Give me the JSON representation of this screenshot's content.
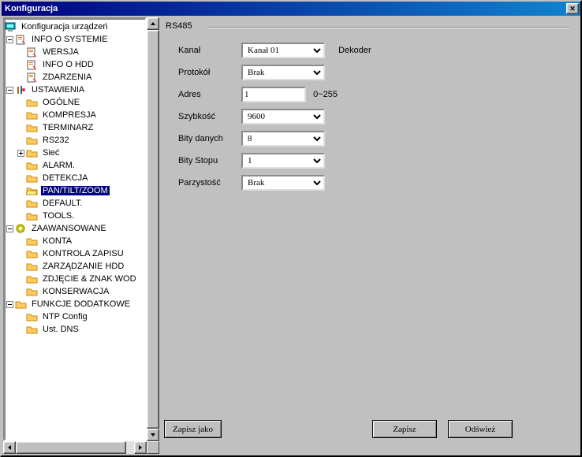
{
  "window": {
    "title": "Konfiguracja"
  },
  "tree": {
    "root": "Konfiguracja urządzeń",
    "info": {
      "title": "INFO O SYSTEMIE",
      "wersja": "WERSJA",
      "hdd": "INFO O HDD",
      "zdarzenia": "ZDARZENIA"
    },
    "settings": {
      "title": "USTAWIENIA",
      "ogolne": "OGÓLNE",
      "kompresja": "KOMPRESJA",
      "terminarz": "TERMINARZ",
      "rs232": "RS232",
      "siec": "Sieć",
      "alarm": "ALARM.",
      "detekcja": "DETEKCJA",
      "ptz": "PAN/TILT/ZOOM",
      "default": "DEFAULT.",
      "tools": "TOOLS."
    },
    "advanced": {
      "title": "ZAAWANSOWANE",
      "konta": "KONTA",
      "kontrola": "KONTROLA ZAPISU",
      "hdd": "ZARZĄDZANIE HDD",
      "znak": "ZDJĘCIE & ZNAK WOD",
      "konserwacja": "KONSERWACJA"
    },
    "extra": {
      "title": "FUNKCJE DODATKOWE",
      "ntp": "NTP Config",
      "dns": "Ust. DNS"
    }
  },
  "rs485": {
    "group_title": "RS485",
    "labels": {
      "kanal": "Kanał",
      "protokol": "Protokół",
      "adres": "Adres",
      "szybkosc": "Szybkość",
      "bity_danych": "Bity danych",
      "bity_stopu": "Bity Stopu",
      "parzystosc": "Parzystość"
    },
    "values": {
      "kanal": "Kanał 01",
      "protokol": "Brak",
      "adres": "1",
      "adres_range": "0~255",
      "szybkosc": "9600",
      "bity_danych": "8",
      "bity_stopu": "1",
      "parzystosc": "Brak"
    },
    "decoder_label": "Dekoder"
  },
  "buttons": {
    "save_as": "Zapisz jako",
    "save": "Zapisz",
    "refresh": "Odśwież"
  }
}
